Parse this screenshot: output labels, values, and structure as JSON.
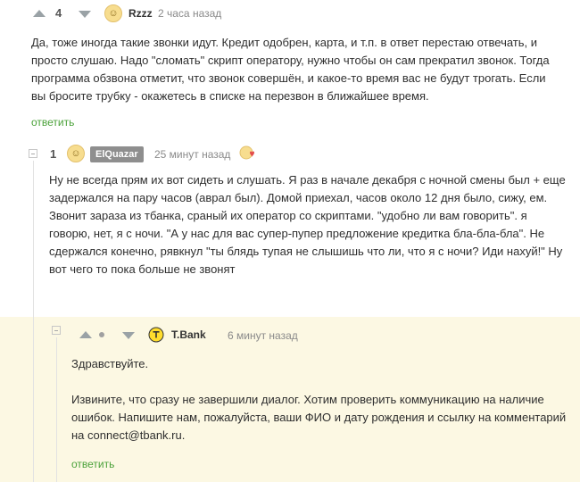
{
  "comment1": {
    "rating": "4",
    "username": "Rzzz",
    "time": "2 часа назад",
    "lines": [
      "Да, тоже иногда такие звонки идут. Кредит одобрен, карта, и т.п. в ответ перестаю отвечать, и",
      "просто слушаю. Надо \"сломать\" скрипт оператору, нужно чтобы он сам прекратил звонок. Тогда",
      "программа обзвона отметит, что звонок совершён, и какое-то время вас не будут трогать. Если",
      "вы бросите трубку - окажетесь в списке на перезвон в ближайшее время."
    ],
    "reply": "ответить"
  },
  "comment2": {
    "rating": "1",
    "username": "ElQuazar",
    "time": "25 минут назад",
    "lines": [
      "Ну не всегда прям их вот сидеть и слушать. Я раз в начале декабря с ночной смены был + еще",
      "задержался на пару часов (аврал был). Домой приехал, часов около 12 дня было, сижу, ем.",
      "Звонит зараза из тбанка, сраный их оператор со скриптами. \"удобно ли вам говорить\". я",
      "говорю, нет, я с ночи. \"А у нас для вас супер-пупер предложение кредитка бла-бла-бла\". Не",
      "сдержался конечно, рявкнул \"ты блядь тупая не слышишь что ли, что я с ночи? Иди нахуй!\" Ну",
      "вот чего то пока больше не звонят"
    ]
  },
  "comment3": {
    "username": "T.Bank",
    "time": "6 минут назад",
    "greeting": "Здравствуйте.",
    "lines": [
      "Извините, что сразу не завершили диалог. Хотим проверить коммуникацию на наличие",
      "ошибок. Напишите нам, пожалуйста, ваши ФИО и дату рождения и ссылку на комментарий",
      "на connect@tbank.ru."
    ],
    "reply": "ответить"
  },
  "colors": {
    "highlight_bg": "#fcf8e3",
    "reply_link": "#4ba23a",
    "badge_bg": "#8e8e8e"
  }
}
